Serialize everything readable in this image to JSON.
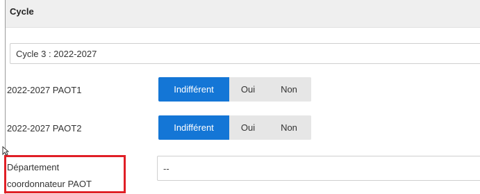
{
  "section": {
    "title": "Cycle"
  },
  "cycle": {
    "selected": "Cycle 3 : 2022-2027"
  },
  "paot_rows": [
    {
      "label": "2022-2027 PAOT1",
      "options": [
        "Indifférent",
        "Oui",
        "Non"
      ],
      "selected": "Indifférent"
    },
    {
      "label": "2022-2027 PAOT2",
      "options": [
        "Indifférent",
        "Oui",
        "Non"
      ],
      "selected": "Indifférent"
    }
  ],
  "departement": {
    "label_line1": "Département",
    "label_line2": "coordonnateur PAOT",
    "selected": "--"
  },
  "colors": {
    "active_toggle": "#1476d6",
    "inactive_toggle": "#e6e6e6",
    "highlight_border": "#e01f26",
    "header_bg": "#efefef"
  },
  "icons": {
    "cursor": "mouse-pointer-icon"
  }
}
